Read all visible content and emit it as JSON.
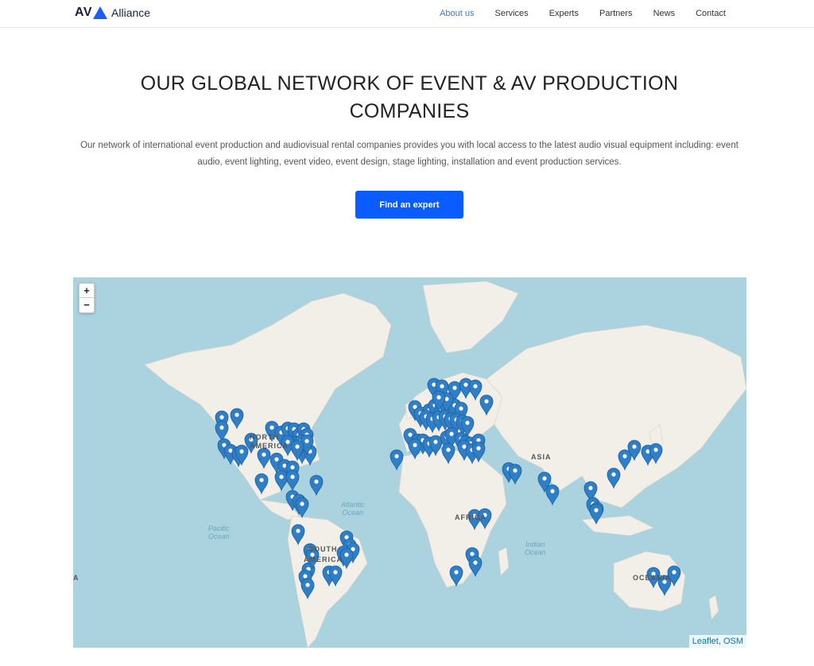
{
  "header": {
    "logo": {
      "prefix": "AV",
      "name": "Alliance"
    },
    "nav": [
      {
        "label": "About us",
        "active": true
      },
      {
        "label": "Services",
        "active": false
      },
      {
        "label": "Experts",
        "active": false
      },
      {
        "label": "Partners",
        "active": false
      },
      {
        "label": "News",
        "active": false
      },
      {
        "label": "Contact",
        "active": false
      }
    ],
    "accent": "#2f7ddb"
  },
  "hero": {
    "title_line1": "OUR GLOBAL NETWORK OF EVENT & AV PRODUCTION",
    "title_line2": "COMPANIES",
    "text_line1": "Our network of international event production and audiovisual rental companies provides you with local access to the latest audio visual equipment including: event",
    "text_line2": "audio, event lighting, event video, event design, stage lighting, installation and event production services.",
    "cta_label": "Find an expert",
    "cta_color": "#0a5cff"
  },
  "map": {
    "zoom_in": "+",
    "zoom_out": "−",
    "attribution_leaflet": "Leaflet",
    "attribution_sep": ", ",
    "attribution_osm": "OSM",
    "labels": {
      "north_america": "NORTH AMERICA",
      "south_america_1": "SOUTH",
      "south_america_2": "AMERICA",
      "asia": "ASIA",
      "africa": "AFRICA",
      "oceania": "OCEANIA",
      "atlantic_1": "Atlantic",
      "atlantic_2": "Ocean",
      "pacific_1": "Pacific",
      "pacific_2": "Ocean",
      "indian_1": "Indian",
      "indian_2": "Ocean",
      "edge_a": "A"
    },
    "marker_color": "#2e7fc7",
    "marker_count": 140,
    "water_color": "#aad3df",
    "land_color": "#f2efe9"
  }
}
